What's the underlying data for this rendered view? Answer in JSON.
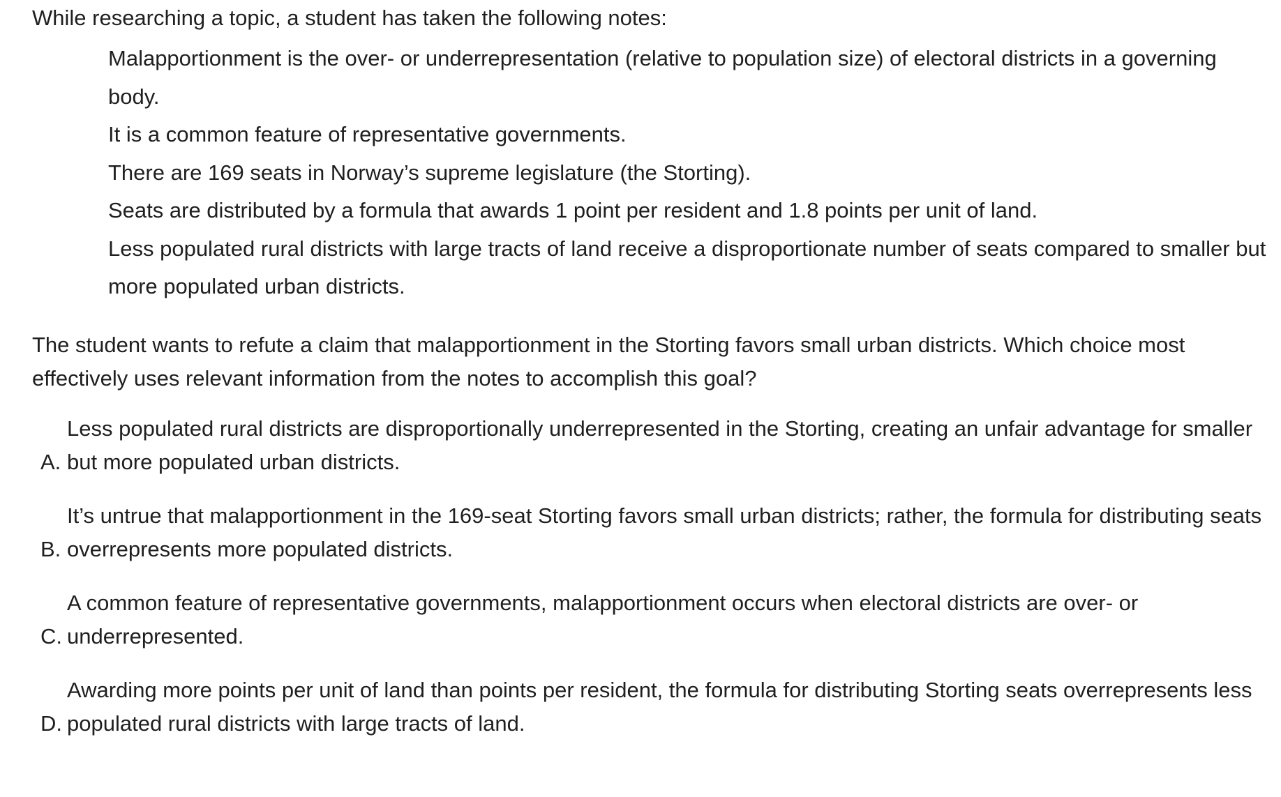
{
  "intro": "While researching a topic, a student has taken the following notes:",
  "notes": [
    "Malapportionment is the over- or underrepresentation (relative to population size) of electoral districts in a governing body.",
    "It is a common feature of representative governments.",
    "There are 169 seats in Norway’s supreme legislature (the Storting).",
    "Seats are distributed by a formula that awards 1 point per resident and 1.8 points per unit of land.",
    "Less populated rural districts with large tracts of land receive a disproportionate number of seats compared to smaller but more populated urban districts."
  ],
  "question": "The student wants to refute a claim that malapportionment in the Storting favors small urban districts. Which choice most effectively uses relevant information from the notes to accomplish this goal?",
  "choices": [
    {
      "letter": "A.",
      "text": "Less populated rural districts are disproportionally underrepresented in the Storting, creating an unfair advantage for smaller but more populated urban districts."
    },
    {
      "letter": "B.",
      "text": "It’s untrue that malapportionment in the 169-seat Storting favors small urban districts; rather, the formula for distributing seats overrepresents more populated districts."
    },
    {
      "letter": "C.",
      "text": "A common feature of representative governments, malapportionment occurs when electoral districts are over- or underrepresented."
    },
    {
      "letter": "D.",
      "text": "Awarding more points per unit of land than points per resident, the formula for distributing Storting seats overrepresents less populated rural districts with large tracts of land."
    }
  ]
}
